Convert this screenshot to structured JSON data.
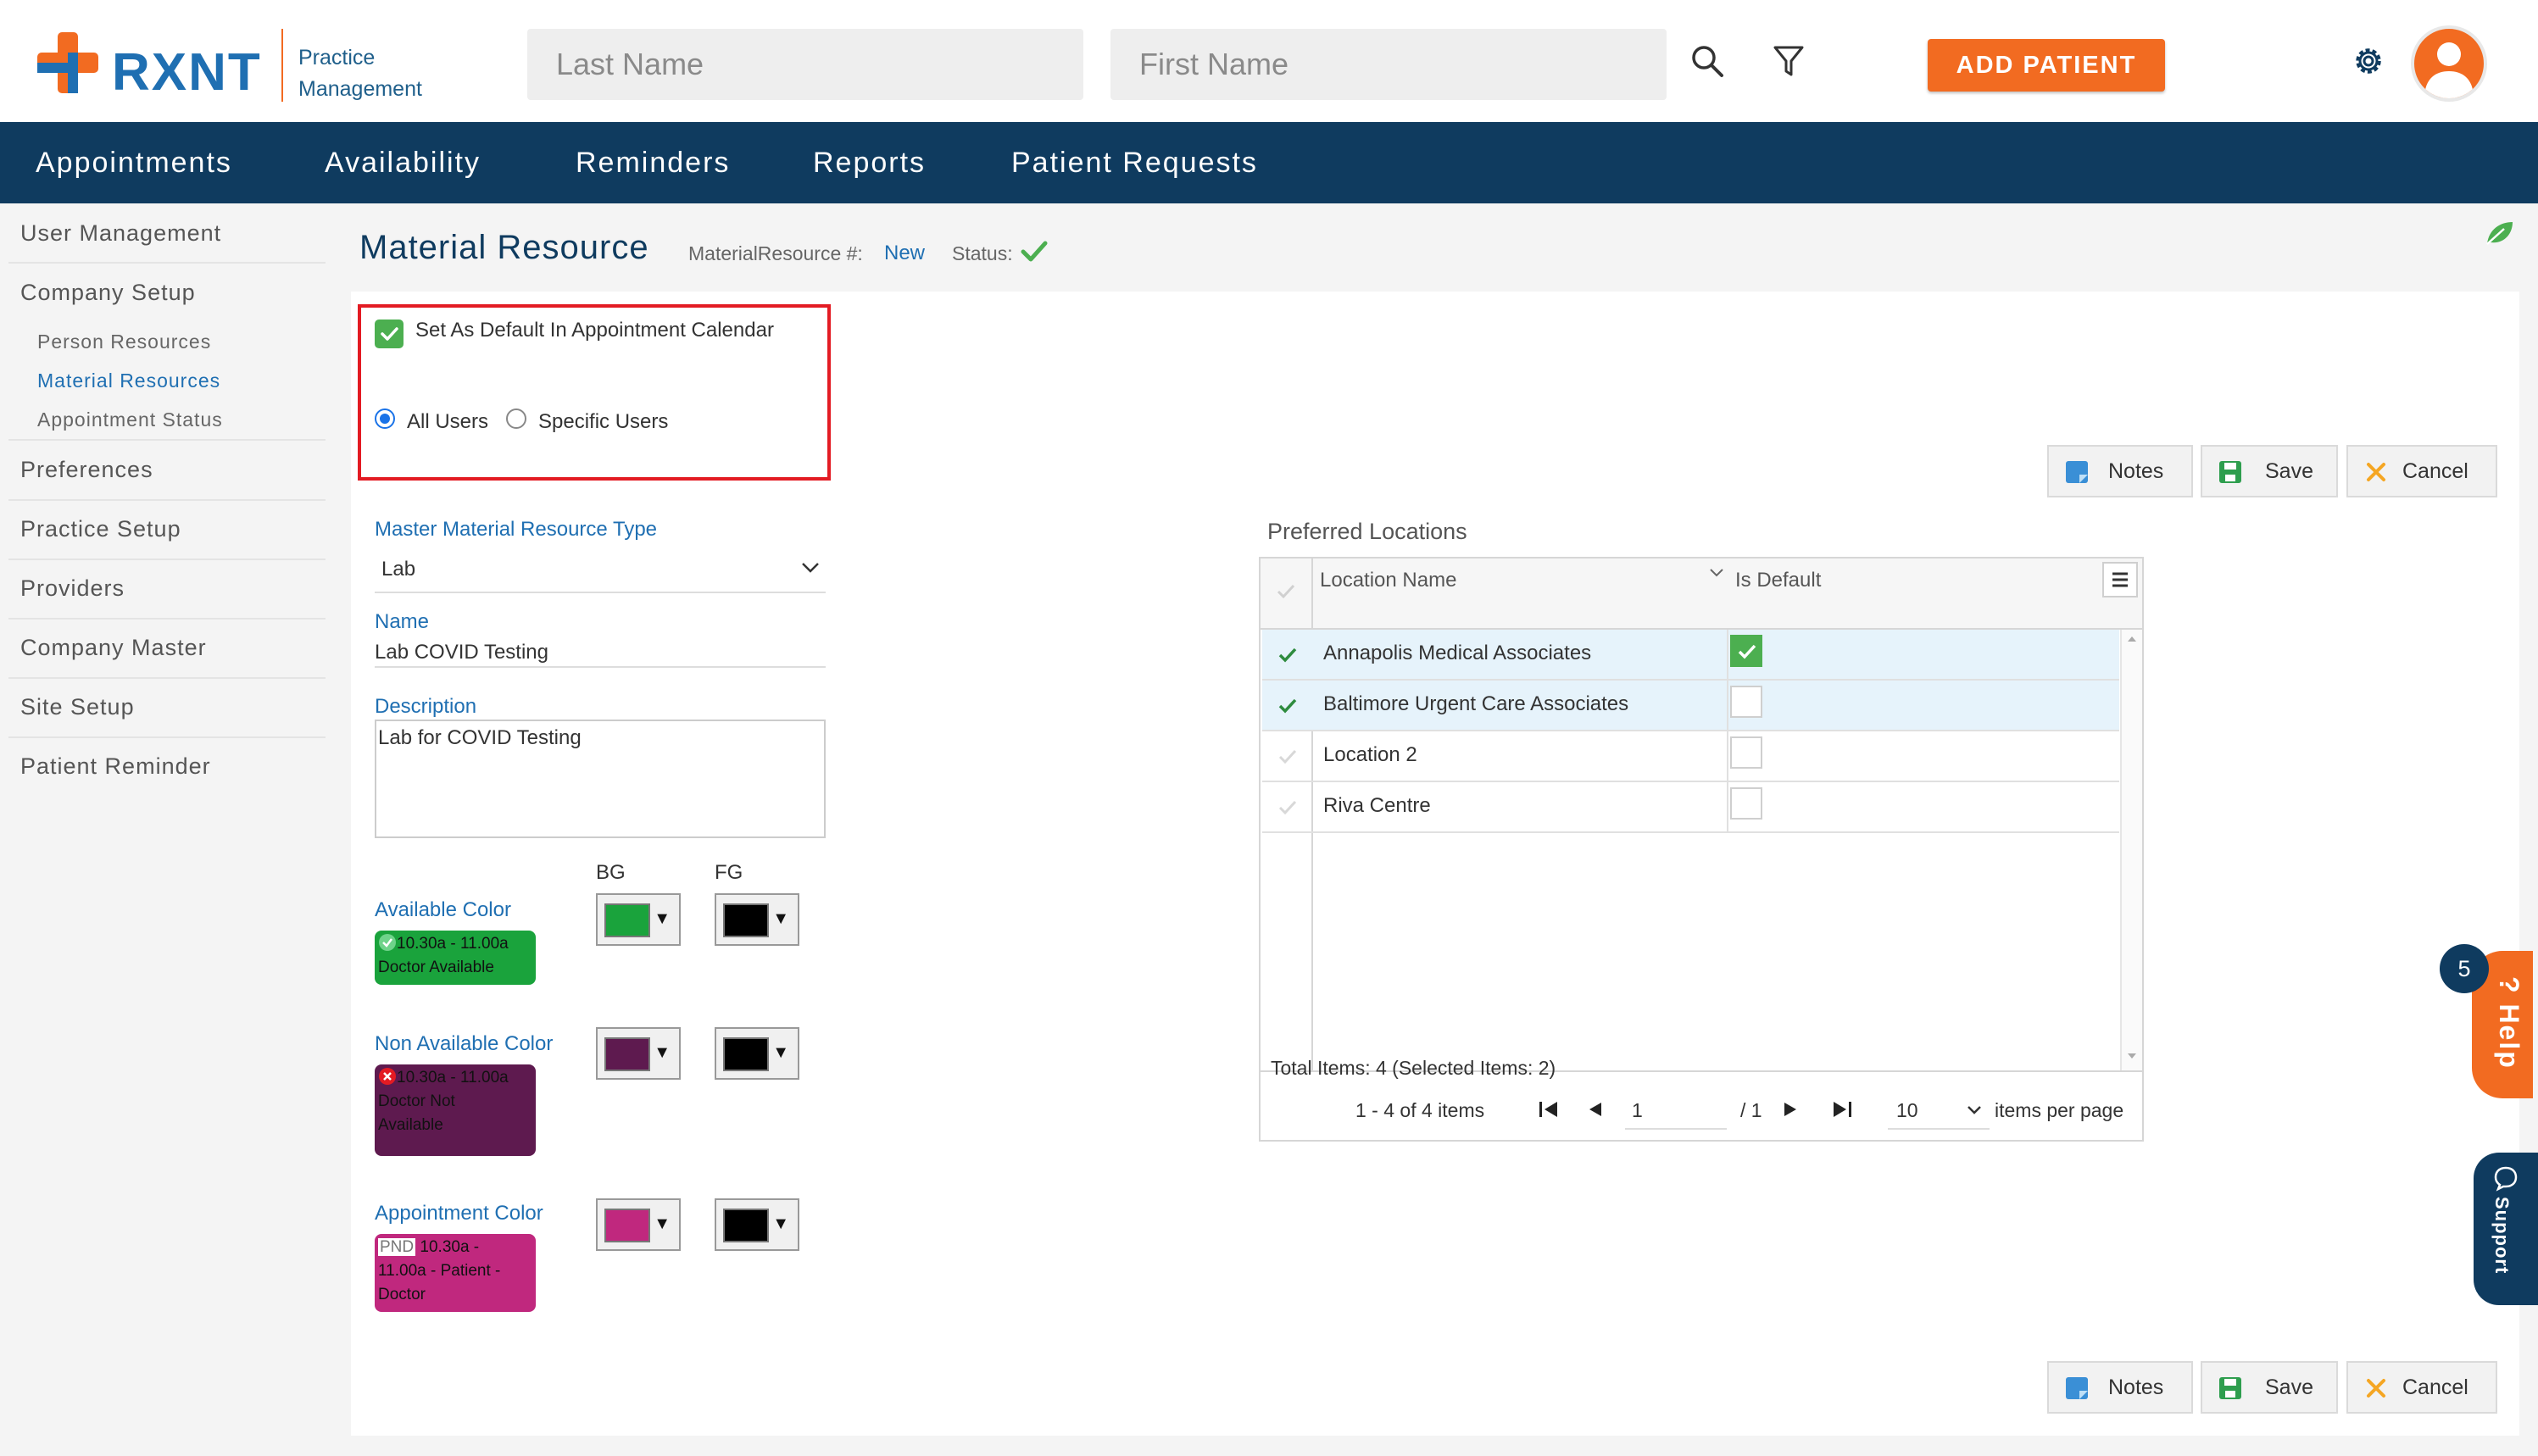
{
  "header": {
    "logo_text": "RXNT",
    "logo_sub_1": "Practice",
    "logo_sub_2": "Management",
    "last_name_placeholder": "Last Name",
    "first_name_placeholder": "First Name",
    "add_patient_label": "ADD PATIENT"
  },
  "nav": {
    "items": [
      "Appointments",
      "Availability",
      "Reminders",
      "Reports",
      "Patient Requests"
    ]
  },
  "sidebar": {
    "user_management": "User Management",
    "company_setup": "Company Setup",
    "sub_items": [
      "Person Resources",
      "Material Resources",
      "Appointment Status"
    ],
    "items": [
      "Preferences",
      "Practice Setup",
      "Providers",
      "Company Master",
      "Site Setup",
      "Patient Reminder"
    ]
  },
  "page": {
    "title": "Material Resource",
    "id_label": "MaterialResource #:",
    "id_value": "New",
    "status_label": "Status:"
  },
  "form": {
    "default_checkbox_label": "Set As Default In Appointment Calendar",
    "default_checked": true,
    "radio_all_users": "All Users",
    "radio_specific_users": "Specific Users",
    "selected_radio": "All Users",
    "type_label": "Master Material Resource Type",
    "type_value": "Lab",
    "name_label": "Name",
    "name_value": "Lab COVID Testing",
    "description_label": "Description",
    "description_value": "Lab for COVID Testing",
    "bg_header": "BG",
    "fg_header": "FG",
    "colors": [
      {
        "label": "Available Color",
        "bg": "#1aa33c",
        "fg": "#000000",
        "preview_line1": "10.30a - 11.00a",
        "preview_line2": "Doctor Available"
      },
      {
        "label": "Non Available Color",
        "bg": "#5e1a4f",
        "fg": "#000000",
        "preview_line1": "10.30a - 11.00a",
        "preview_line2": "Doctor Not",
        "preview_line3": "Available"
      },
      {
        "label": "Appointment Color",
        "bg": "#c0287e",
        "fg": "#000000",
        "preview_tag": "PND",
        "preview_line1": "10.30a -",
        "preview_line2": "11.00a - Patient -",
        "preview_line3": "Doctor"
      }
    ]
  },
  "actions": {
    "notes": "Notes",
    "save": "Save",
    "cancel": "Cancel"
  },
  "locations": {
    "title": "Preferred Locations",
    "col_location": "Location Name",
    "col_default": "Is Default",
    "rows": [
      {
        "name": "Annapolis Medical Associates",
        "selected": true,
        "is_default": true
      },
      {
        "name": "Baltimore Urgent Care Associates",
        "selected": true,
        "is_default": false
      },
      {
        "name": "Location 2",
        "selected": false,
        "is_default": false
      },
      {
        "name": "Riva Centre",
        "selected": false,
        "is_default": false
      }
    ],
    "total_text": "Total Items: 4 (Selected Items: 2)",
    "range_text": "1 - 4 of 4 items",
    "page_value": "1",
    "page_total": "/ 1",
    "page_size": "10",
    "per_page_label": "items per page"
  },
  "widgets": {
    "help_label": "Help",
    "help_badge": "5",
    "support_label": "Support"
  }
}
